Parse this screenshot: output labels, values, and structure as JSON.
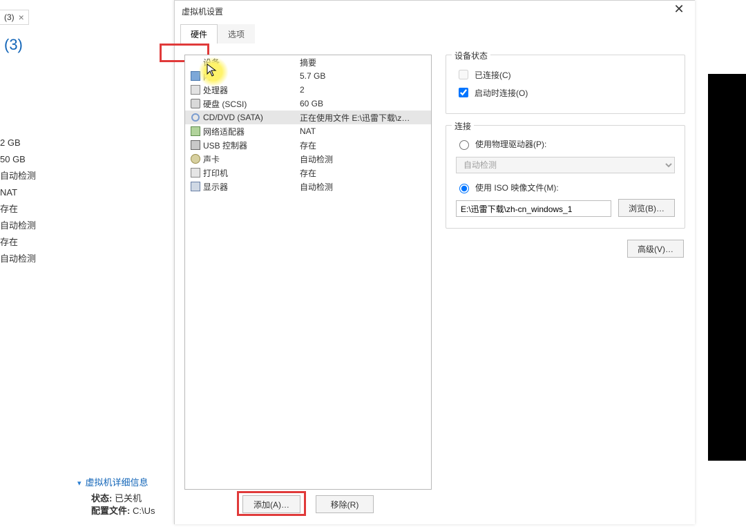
{
  "host": {
    "tab_label": "(3)",
    "title": "(3)",
    "summary_values": [
      "2 GB",
      "50 GB",
      "自动检测",
      "NAT",
      "存在",
      "自动检测",
      "存在",
      "自动检测"
    ],
    "details_header": "虚拟机详细信息",
    "status_label": "状态:",
    "status_value": "已关机",
    "config_label": "配置文件:",
    "config_value": "C:\\Us"
  },
  "dialog": {
    "title": "虚拟机设置",
    "tabs": {
      "hardware": "硬件",
      "options": "选项"
    },
    "columns": {
      "device": "设备",
      "summary": "摘要"
    },
    "hardware": [
      {
        "icon": "ic-mem",
        "device": "内存",
        "summary": "5.7 GB"
      },
      {
        "icon": "ic-cpu",
        "device": "处理器",
        "summary": "2"
      },
      {
        "icon": "ic-disk",
        "device": "硬盘 (SCSI)",
        "summary": "60 GB"
      },
      {
        "icon": "ic-cd",
        "device": "CD/DVD (SATA)",
        "summary": "正在使用文件 E:\\迅雷下载\\z…",
        "selected": true
      },
      {
        "icon": "ic-net",
        "device": "网络适配器",
        "summary": "NAT"
      },
      {
        "icon": "ic-usb",
        "device": "USB 控制器",
        "summary": "存在"
      },
      {
        "icon": "ic-snd",
        "device": "声卡",
        "summary": "自动检测"
      },
      {
        "icon": "ic-prn",
        "device": "打印机",
        "summary": "存在"
      },
      {
        "icon": "ic-mon",
        "device": "显示器",
        "summary": "自动检测"
      }
    ],
    "buttons": {
      "add": "添加(A)…",
      "remove": "移除(R)"
    },
    "right": {
      "status_title": "设备状态",
      "connected": "已连接(C)",
      "connect_power_on": "启动时连接(O)",
      "connection_title": "连接",
      "use_physical": "使用物理驱动器(P):",
      "physical_value": "自动检测",
      "use_iso": "使用 ISO 映像文件(M):",
      "iso_path": "E:\\迅雷下载\\zh-cn_windows_1",
      "browse": "浏览(B)…",
      "advanced": "高级(V)…"
    }
  }
}
